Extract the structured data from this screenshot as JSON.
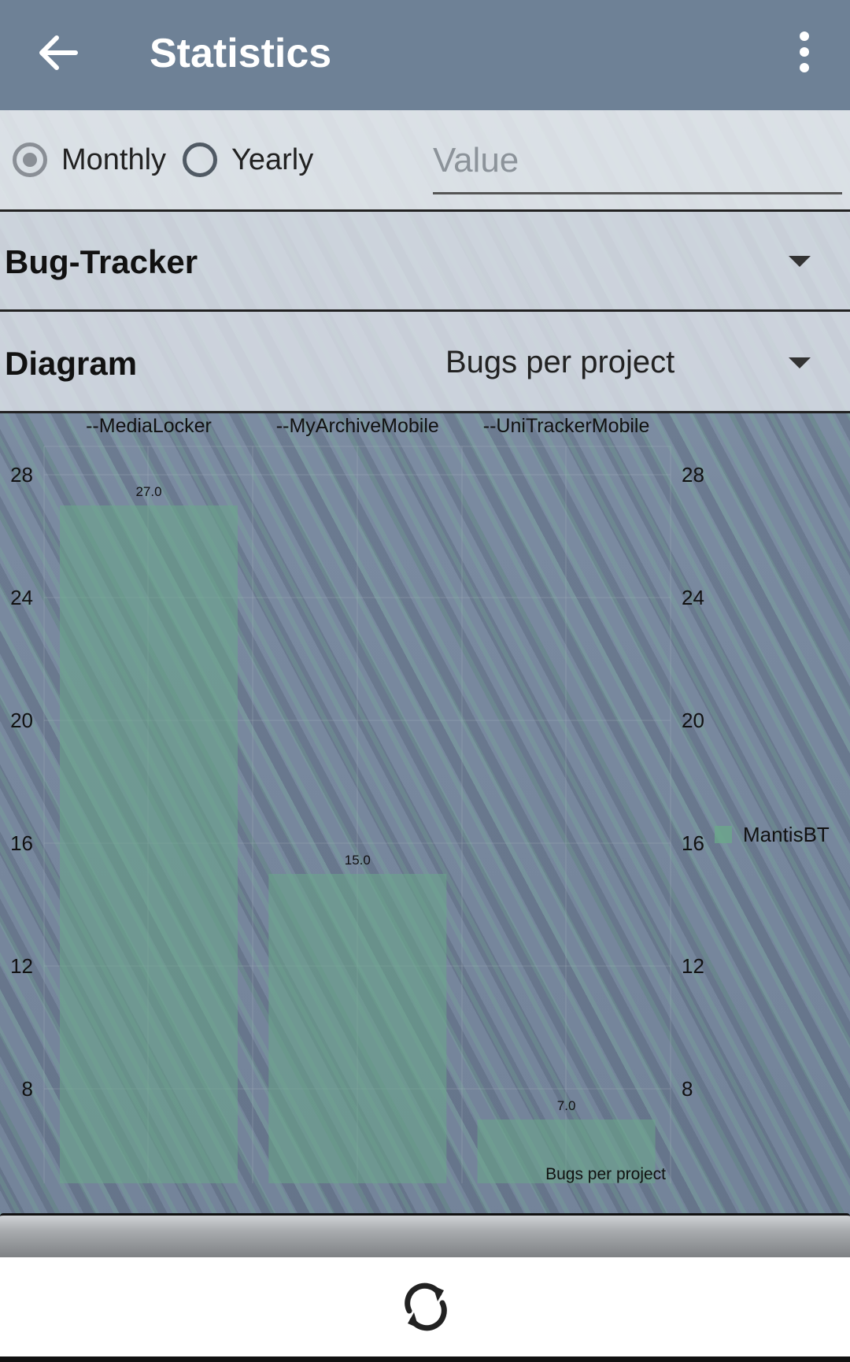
{
  "appbar": {
    "title": "Statistics"
  },
  "period": {
    "monthly_label": "Monthly",
    "yearly_label": "Yearly",
    "selected": "Monthly"
  },
  "value_field": {
    "placeholder": "Value",
    "value": ""
  },
  "tracker": {
    "label": "Bug-Tracker"
  },
  "diagram": {
    "label": "Diagram",
    "value": "Bugs per project"
  },
  "chart_data": {
    "type": "bar",
    "categories": [
      "--MediaLocker",
      "--MyArchiveMobile",
      "--UniTrackerMobile"
    ],
    "series": [
      {
        "name": "MantisBT",
        "values": [
          27.0,
          15.0,
          7.0
        ]
      }
    ],
    "value_labels": [
      "27.0",
      "15.0",
      "7.0"
    ],
    "yticks": [
      "8",
      "12",
      "16",
      "20",
      "24",
      "28"
    ],
    "ylim": [
      5,
      29
    ],
    "description": "Bugs per project",
    "bar_color": "#6aa88a",
    "legend_position": "right"
  }
}
